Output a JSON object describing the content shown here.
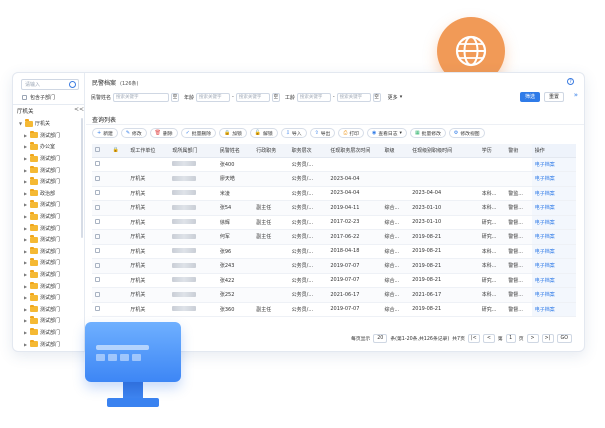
{
  "sidebar": {
    "search_placeholder": "请输入",
    "include_child": "包含子部门",
    "root": "厅机关",
    "collapse": "<<",
    "tree": [
      {
        "label": "厅机关",
        "level": 1,
        "expanded": true
      },
      {
        "label": "测试部门",
        "level": 2
      },
      {
        "label": "办公室",
        "level": 2
      },
      {
        "label": "测试部门",
        "level": 2
      },
      {
        "label": "测试部门",
        "level": 2
      },
      {
        "label": "测试部门",
        "level": 2
      },
      {
        "label": "政治部",
        "level": 2
      },
      {
        "label": "测试部门",
        "level": 2
      },
      {
        "label": "测试部门",
        "level": 2
      },
      {
        "label": "测试部门",
        "level": 2
      },
      {
        "label": "测试部门",
        "level": 2
      },
      {
        "label": "测试部门",
        "level": 2
      },
      {
        "label": "测试部门",
        "level": 2
      },
      {
        "label": "测试部门",
        "level": 2
      },
      {
        "label": "测试部门",
        "level": 2
      },
      {
        "label": "测试部门",
        "level": 2
      },
      {
        "label": "测试部门",
        "level": 2
      },
      {
        "label": "测试部门",
        "level": 2
      },
      {
        "label": "测试部门",
        "level": 2
      },
      {
        "label": "测试部门",
        "level": 2
      }
    ]
  },
  "header": {
    "title": "民警档案",
    "count": "(126条)",
    "help": "?"
  },
  "filters": [
    {
      "label": "民警姓名",
      "placeholder": "搜索关键字",
      "op": "空"
    },
    {
      "label": "年龄",
      "placeholder": "搜索关键字",
      "sep": "-",
      "placeholder2": "搜索关键字",
      "op": "空"
    },
    {
      "label": "工龄",
      "placeholder": "搜索关键字",
      "sep": "-",
      "placeholder2": "搜索关键字",
      "op": "空"
    }
  ],
  "filter_more": "更多",
  "search_button": "筛选",
  "reset_button": "重置",
  "expand": "»",
  "section_title": "查询列表",
  "toolbar": [
    {
      "icon": "+",
      "label": "新建",
      "icon_name": "plus-icon"
    },
    {
      "icon": "✎",
      "label": "修改",
      "icon_name": "edit-icon"
    },
    {
      "icon": "🗑",
      "label": "删除",
      "icon_name": "trash-icon"
    },
    {
      "icon": "✓",
      "label": "批量删除",
      "icon_name": "batch-delete-icon"
    },
    {
      "icon": "🔒",
      "label": "加锁",
      "icon_name": "lock-icon"
    },
    {
      "icon": "🔓",
      "label": "解锁",
      "icon_name": "unlock-icon"
    },
    {
      "icon": "⇩",
      "label": "导入",
      "icon_name": "import-icon"
    },
    {
      "icon": "⇧",
      "label": "导出",
      "icon_name": "export-icon"
    },
    {
      "icon": "⎙",
      "label": "打印",
      "icon_name": "print-icon"
    },
    {
      "icon": "◉",
      "label": "查看日志",
      "icon_name": "log-icon",
      "dropdown": "▾"
    },
    {
      "icon": "▦",
      "label": "批量修改",
      "icon_name": "batch-edit-icon"
    },
    {
      "icon": "⚙",
      "label": "修改视图",
      "icon_name": "view-settings-icon"
    }
  ],
  "table": {
    "columns": [
      "",
      "",
      "现工作单位",
      "现所属部门",
      "民警姓名",
      "行政职务",
      "职务层次",
      "任现职务层次时间",
      "职级",
      "任现级别职级时间",
      "学历",
      "警衔",
      "操作"
    ],
    "rows": [
      {
        "unit": "",
        "dept": "",
        "name": "张400",
        "admin": "",
        "level": "公务员/...",
        "level_date": "",
        "rank": "",
        "rank_date": "",
        "edu": "",
        "badge": "",
        "op": "电子档案"
      },
      {
        "unit": "厅机关",
        "dept": "",
        "name": "廖天皓",
        "admin": "",
        "level": "公务员/...",
        "level_date": "2023-04-04",
        "rank": "",
        "rank_date": "",
        "edu": "",
        "badge": "",
        "op": "电子档案"
      },
      {
        "unit": "厅机关",
        "dept": "",
        "name": "米凌",
        "admin": "",
        "level": "公务员/...",
        "level_date": "2023-04-04",
        "rank": "",
        "rank_date": "2023-04-04",
        "edu": "本科...",
        "badge": "警监...",
        "op": "电子档案"
      },
      {
        "unit": "厅机关",
        "dept": "",
        "name": "张54",
        "admin": "副主任",
        "level": "公务员/...",
        "level_date": "2019-04-11",
        "rank": "综合...",
        "rank_date": "2023-01-10",
        "edu": "本科...",
        "badge": "警督...",
        "op": "电子档案"
      },
      {
        "unit": "厅机关",
        "dept": "",
        "name": "徐辉",
        "admin": "副主任",
        "level": "公务员/...",
        "level_date": "2017-02-23",
        "rank": "综合...",
        "rank_date": "2023-01-10",
        "edu": "研究...",
        "badge": "警督...",
        "op": "电子档案"
      },
      {
        "unit": "厅机关",
        "dept": "",
        "name": "何军",
        "admin": "副主任",
        "level": "公务员/...",
        "level_date": "2017-06-22",
        "rank": "综合...",
        "rank_date": "2019-08-21",
        "edu": "研究...",
        "badge": "警督...",
        "op": "电子档案"
      },
      {
        "unit": "厅机关",
        "dept": "",
        "name": "张96",
        "admin": "",
        "level": "公务员/...",
        "level_date": "2018-04-18",
        "rank": "综合...",
        "rank_date": "2019-08-21",
        "edu": "本科...",
        "badge": "警督...",
        "op": "电子档案"
      },
      {
        "unit": "厅机关",
        "dept": "",
        "name": "张243",
        "admin": "",
        "level": "公务员/...",
        "level_date": "2019-07-07",
        "rank": "综合...",
        "rank_date": "2019-08-21",
        "edu": "本科...",
        "badge": "警督...",
        "op": "电子档案"
      },
      {
        "unit": "厅机关",
        "dept": "",
        "name": "张422",
        "admin": "",
        "level": "公务员/...",
        "level_date": "2019-07-07",
        "rank": "综合...",
        "rank_date": "2019-08-21",
        "edu": "研究...",
        "badge": "警督...",
        "op": "电子档案"
      },
      {
        "unit": "厅机关",
        "dept": "",
        "name": "张252",
        "admin": "",
        "level": "公务员/...",
        "level_date": "2021-06-17",
        "rank": "综合...",
        "rank_date": "2021-06-17",
        "edu": "本科...",
        "badge": "警督...",
        "op": "电子档案"
      },
      {
        "unit": "厅机关",
        "dept": "",
        "name": "张360",
        "admin": "副主任",
        "level": "公务员/...",
        "level_date": "2019-07-07",
        "rank": "综合...",
        "rank_date": "2019-08-21",
        "edu": "研究...",
        "badge": "警督...",
        "op": "电子档案"
      }
    ]
  },
  "pagination": {
    "per_page_label": "每页显示",
    "per_page": "20",
    "total_text": "条(第1-20条,共126条记录)",
    "pages_text": "共7页",
    "first": "|<",
    "prev": "<",
    "page_label_pre": "第",
    "current": "1",
    "page_label_post": "页",
    "next": ">",
    "last": ">|",
    "go": "GO"
  },
  "colors": {
    "accent": "#2f7be8",
    "badge_orange": "#f19a57",
    "monitor_blue": "#3d86f5",
    "folder": "#f5b934"
  }
}
